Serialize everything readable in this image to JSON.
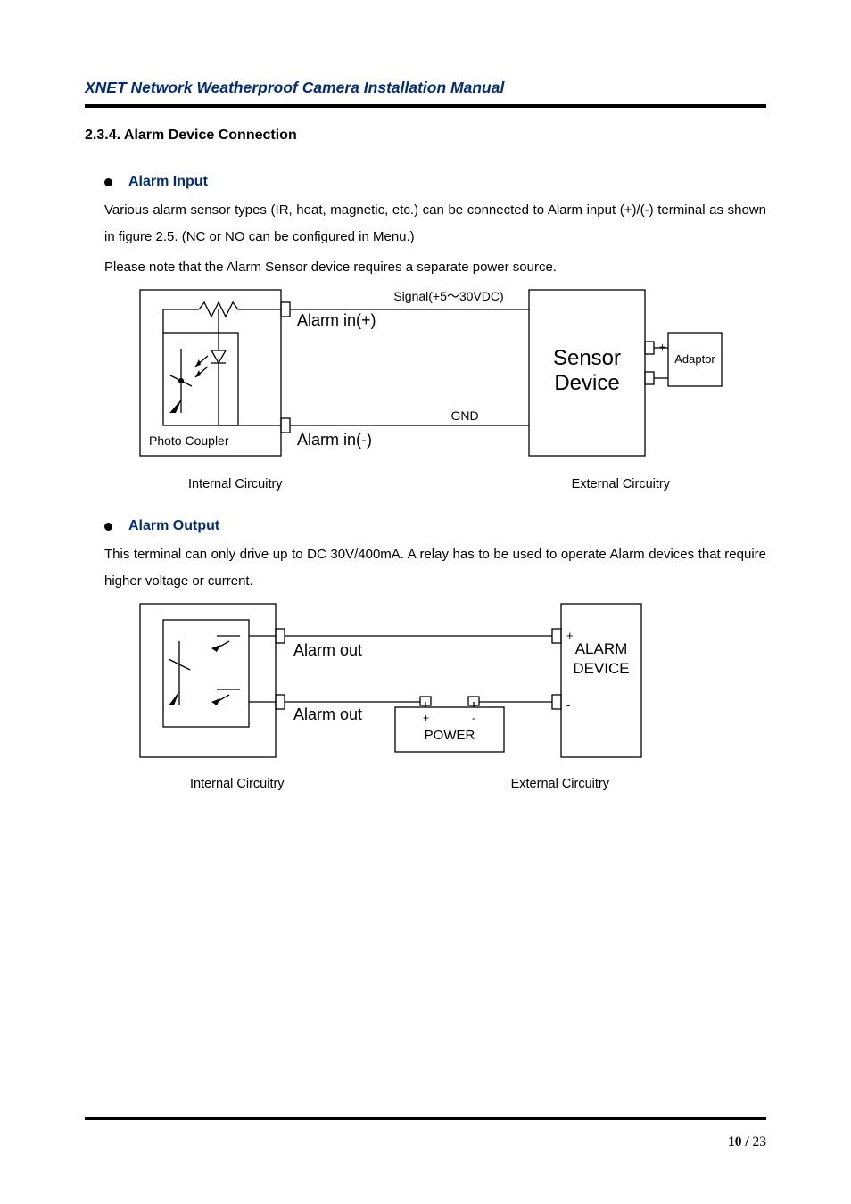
{
  "header": "XNET Network Weatherproof Camera Installation Manual",
  "section": {
    "number": "2.3.4.",
    "title": "Alarm Device Connection"
  },
  "alarm_input": {
    "heading": "Alarm Input",
    "p1": "Various alarm sensor types (IR, heat, magnetic, etc.) can be connected to Alarm input (+)/(-) terminal as shown in figure 2.5. (NC or NO can be configured in Menu.)",
    "p2": "Please note that the Alarm Sensor device requires a separate power source.",
    "d": {
      "signal": "Signal(+5～30VDC)",
      "in_p": "Alarm in(+)",
      "in_n": "Alarm in(-)",
      "photo": "Photo Coupler",
      "sensor1": "Sensor",
      "sensor2": "Device",
      "adaptor": "Adaptor",
      "plus": "+",
      "minus": "-",
      "gnd": "GND"
    },
    "cap_left": "Internal Circuitry",
    "cap_right": "External Circuitry"
  },
  "alarm_output": {
    "heading": "Alarm Output",
    "p1": "This terminal can only drive up to DC 30V/400mA.   A relay has to be used to operate Alarm devices that require higher voltage or current.",
    "d": {
      "out1": "Alarm out",
      "out2": "Alarm out",
      "power": "POWER",
      "dev1": "ALARM",
      "dev2": "DEVICE",
      "plus": "+",
      "minus": "-"
    },
    "cap_left": "Internal Circuitry",
    "cap_right": "External Circuitry"
  },
  "footer": {
    "page": "10",
    "sep": " / ",
    "total": "23"
  }
}
